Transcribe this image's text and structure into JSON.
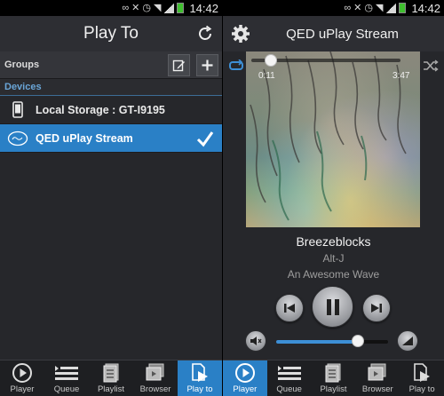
{
  "status_bar": {
    "time": "14:42"
  },
  "play_to_screen": {
    "title": "Play To",
    "groups_label": "Groups",
    "devices_label": "Devices",
    "devices": [
      {
        "name": "Local Storage : GT-I9195",
        "icon": "phone-icon",
        "selected": false
      },
      {
        "name": "QED uPlay Stream",
        "icon": "qed-uplay-logo-icon",
        "selected": true
      }
    ]
  },
  "player_screen": {
    "title": "QED uPlay Stream",
    "elapsed": "0:11",
    "total": "3:47",
    "progress": 0.048,
    "track_title": "Breezeblocks",
    "artist": "Alt-J",
    "album": "An Awesome Wave",
    "volume": 0.7
  },
  "tabs": {
    "player": "Player",
    "queue": "Queue",
    "playlist": "Playlist",
    "browser": "Browser",
    "play_to_left": "Play to",
    "play_to_right": "Play to"
  },
  "colors": {
    "accent": "#2a80c6",
    "background": "#26272b"
  }
}
